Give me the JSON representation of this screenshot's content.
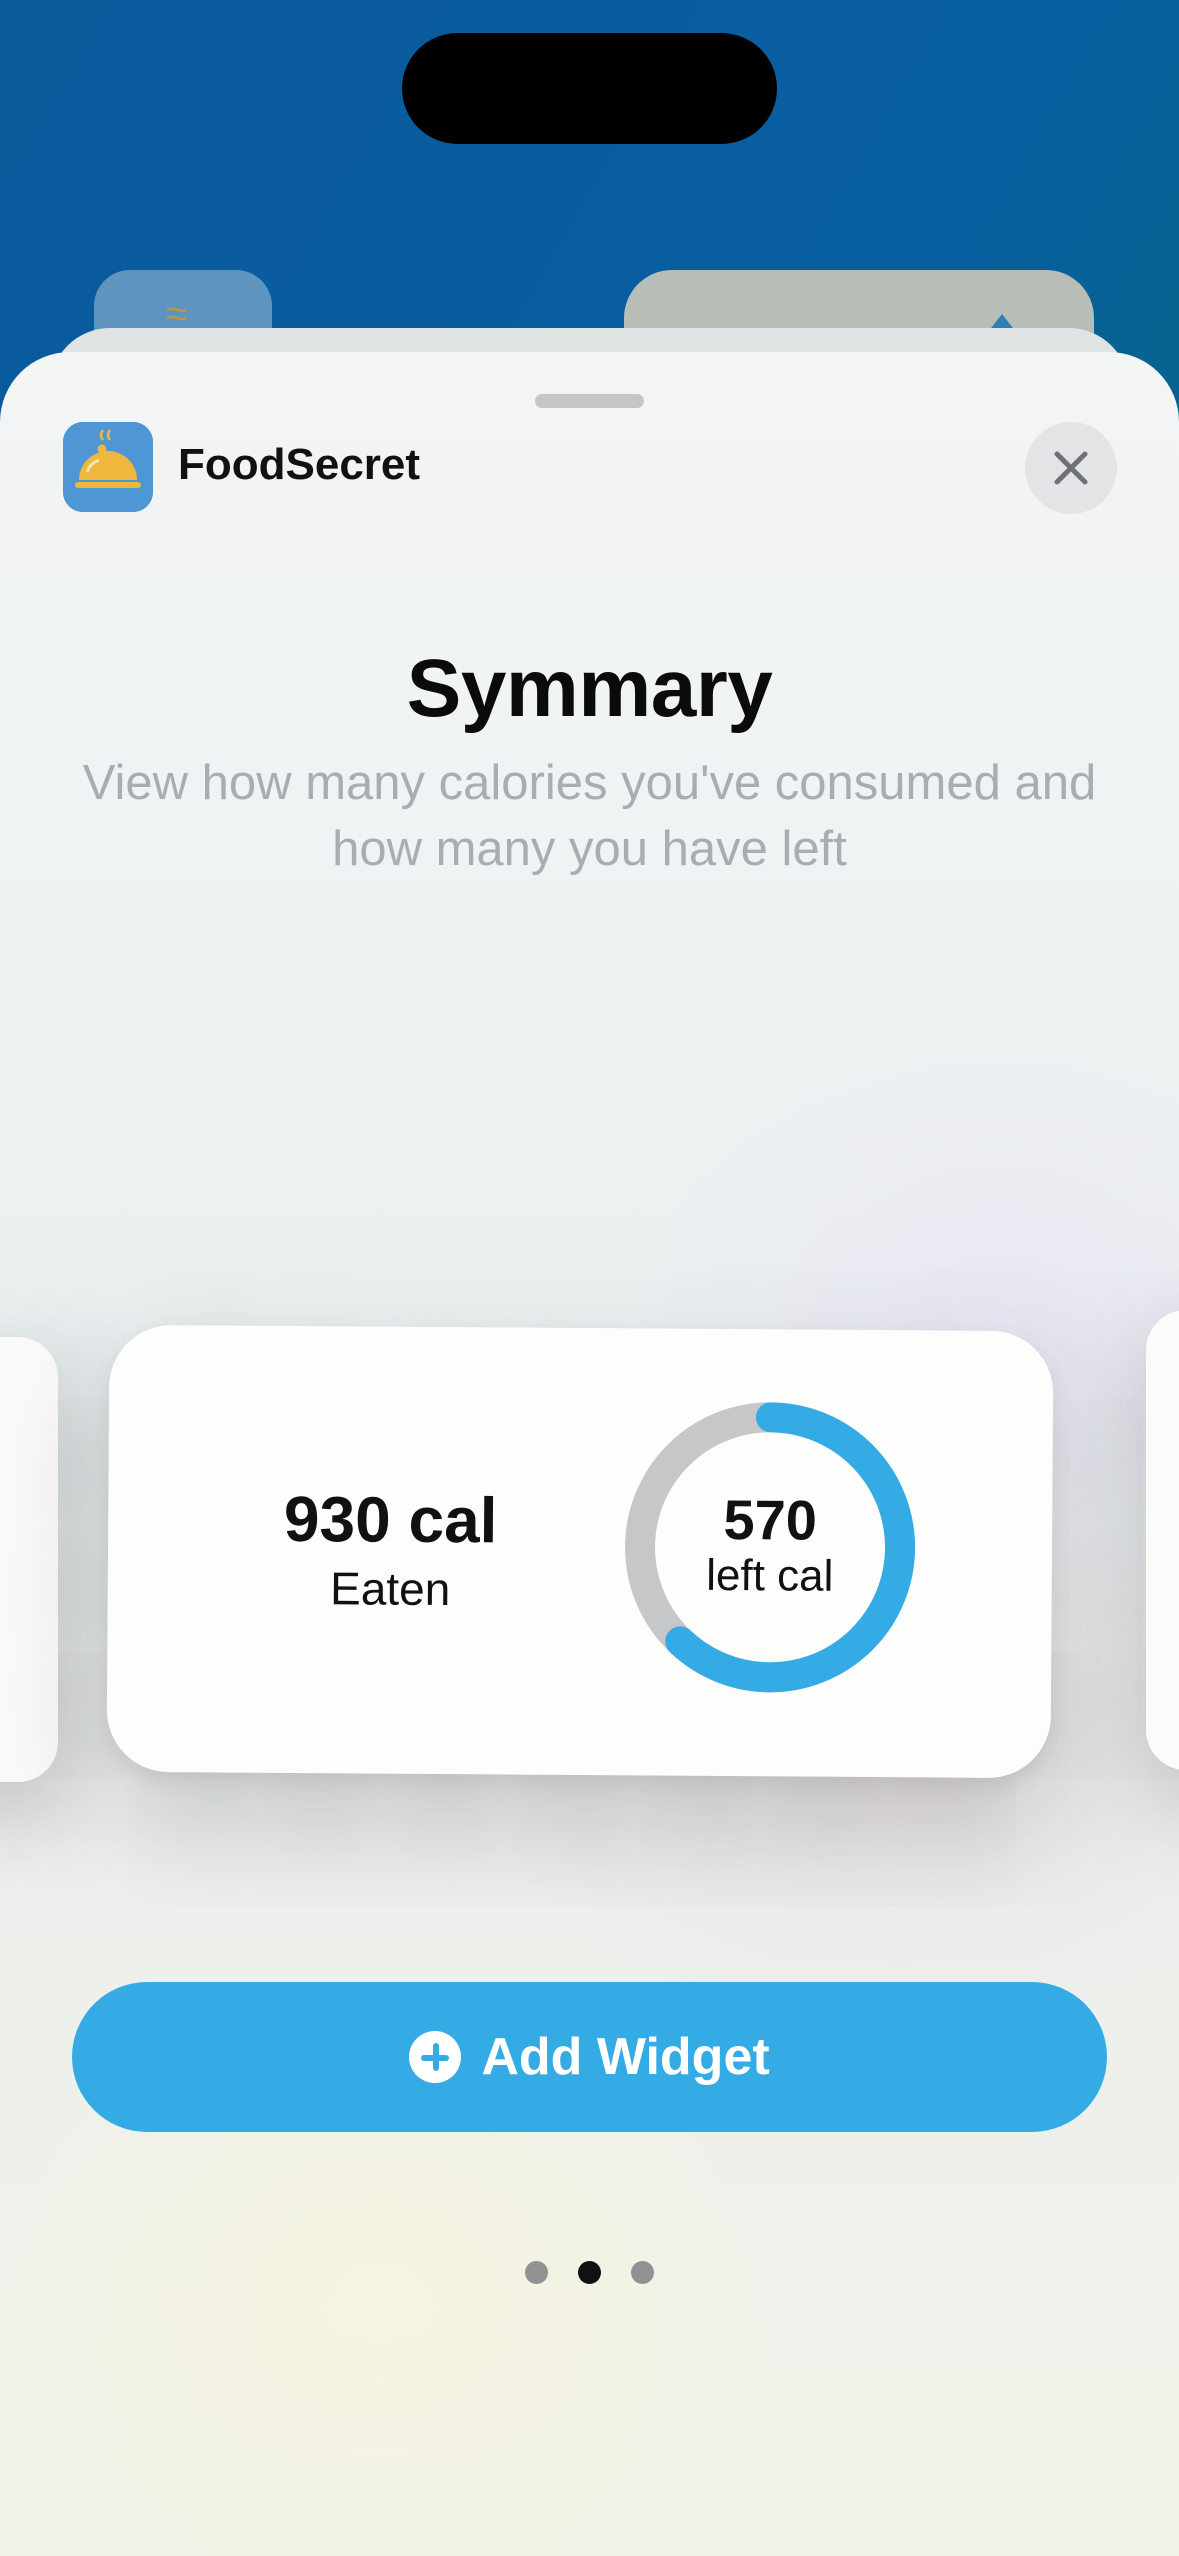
{
  "app": {
    "name": "FoodSecret",
    "icon": "food-cloche-icon",
    "icon_bg_color": "#4f97d4",
    "icon_fg_color": "#f0b73e"
  },
  "widget": {
    "title": "Symmary",
    "description": "View how many calories you've consumed and how many you have left",
    "eaten_value": "930 cal",
    "eaten_label": "Eaten",
    "left_value": "570",
    "left_label": "left cal",
    "progress_fraction": 0.62,
    "ring_color": "#35abe6",
    "ring_track_color": "#c5c7c8"
  },
  "pager": {
    "pages": 3,
    "active_index": 1
  },
  "add_button": {
    "label": "Add Widget",
    "color": "#35abe6"
  },
  "close_icon": "close-icon"
}
